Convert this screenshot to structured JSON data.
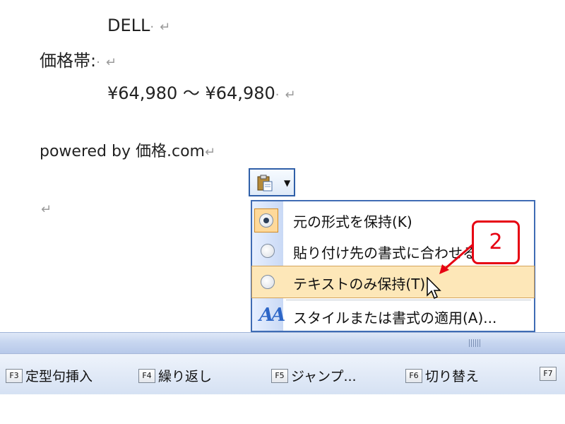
{
  "document": {
    "line_brand": "DELL",
    "line_price_label": "価格帯:",
    "line_price_range": "¥64,980 ～ ¥64,980",
    "line_powered": "powered by 価格.com",
    "space_mark": "·",
    "para_mark": "↵"
  },
  "paste_options": {
    "button_icon": "clipboard-paste-icon",
    "dropdown_icon": "dropdown-arrow-icon",
    "menu": [
      {
        "label": "元の形式を保持(K)",
        "selected": true
      },
      {
        "label": "貼り付け先の書式に合わせる",
        "selected": false
      },
      {
        "label": "テキストのみ保持(T)",
        "selected": false,
        "hovered": true
      },
      {
        "label": "スタイルまたは書式の適用(A)...",
        "icon": "style-apply-icon"
      }
    ]
  },
  "annotation": {
    "number": "2",
    "color": "#e60012"
  },
  "function_keys": [
    {
      "key": "F3",
      "label": "定型句挿入"
    },
    {
      "key": "F4",
      "label": "繰り返し"
    },
    {
      "key": "F5",
      "label": "ジャンプ..."
    },
    {
      "key": "F6",
      "label": "切り替え"
    },
    {
      "key": "F7",
      "label": ""
    }
  ]
}
